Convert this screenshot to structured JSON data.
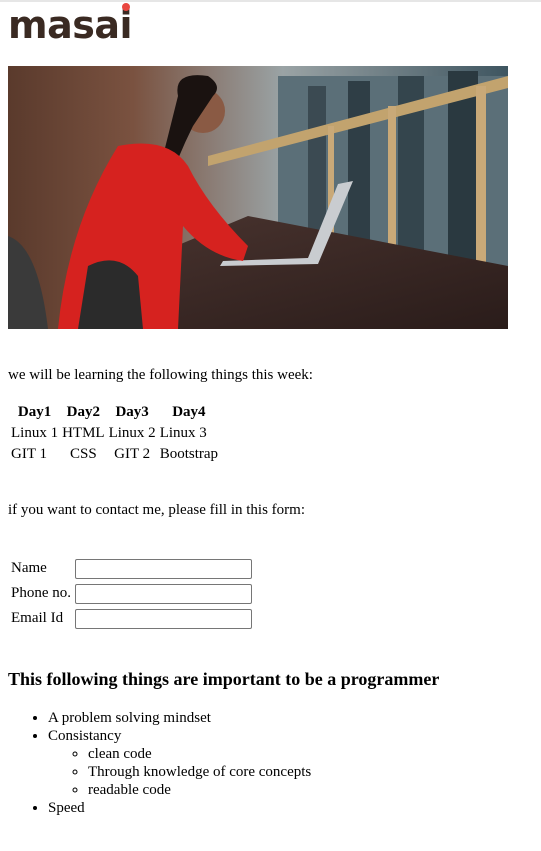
{
  "brand": {
    "logo_text_a": "mas",
    "logo_text_i": "a",
    "logo_text_b": "i",
    "accent_color": "#e9463f",
    "text_color": "#3a2a22"
  },
  "hero": {
    "alt": "Woman in red sweater working on a laptop"
  },
  "intro": "we will be learning the following things this week:",
  "schedule": {
    "headers": [
      "Day1",
      "Day2",
      "Day3",
      "Day4"
    ],
    "rows": [
      [
        "Linux 1",
        "HTML",
        "Linux 2",
        "Linux 3"
      ],
      [
        "GIT 1",
        "CSS",
        "GIT 2",
        "Bootstrap"
      ]
    ]
  },
  "contact_prompt": "if you want to contact me, please fill in this form:",
  "form": {
    "fields": [
      {
        "label": "Name",
        "value": ""
      },
      {
        "label": "Phone no.",
        "value": ""
      },
      {
        "label": "Email Id",
        "value": ""
      }
    ]
  },
  "programmer": {
    "title": "This following things are important to be a programmer",
    "items": [
      {
        "text": "A problem solving mindset"
      },
      {
        "text": "Consistancy",
        "children": [
          "clean code",
          "Through knowledge of core concepts",
          "readable code"
        ]
      },
      {
        "text": "Speed"
      }
    ]
  }
}
